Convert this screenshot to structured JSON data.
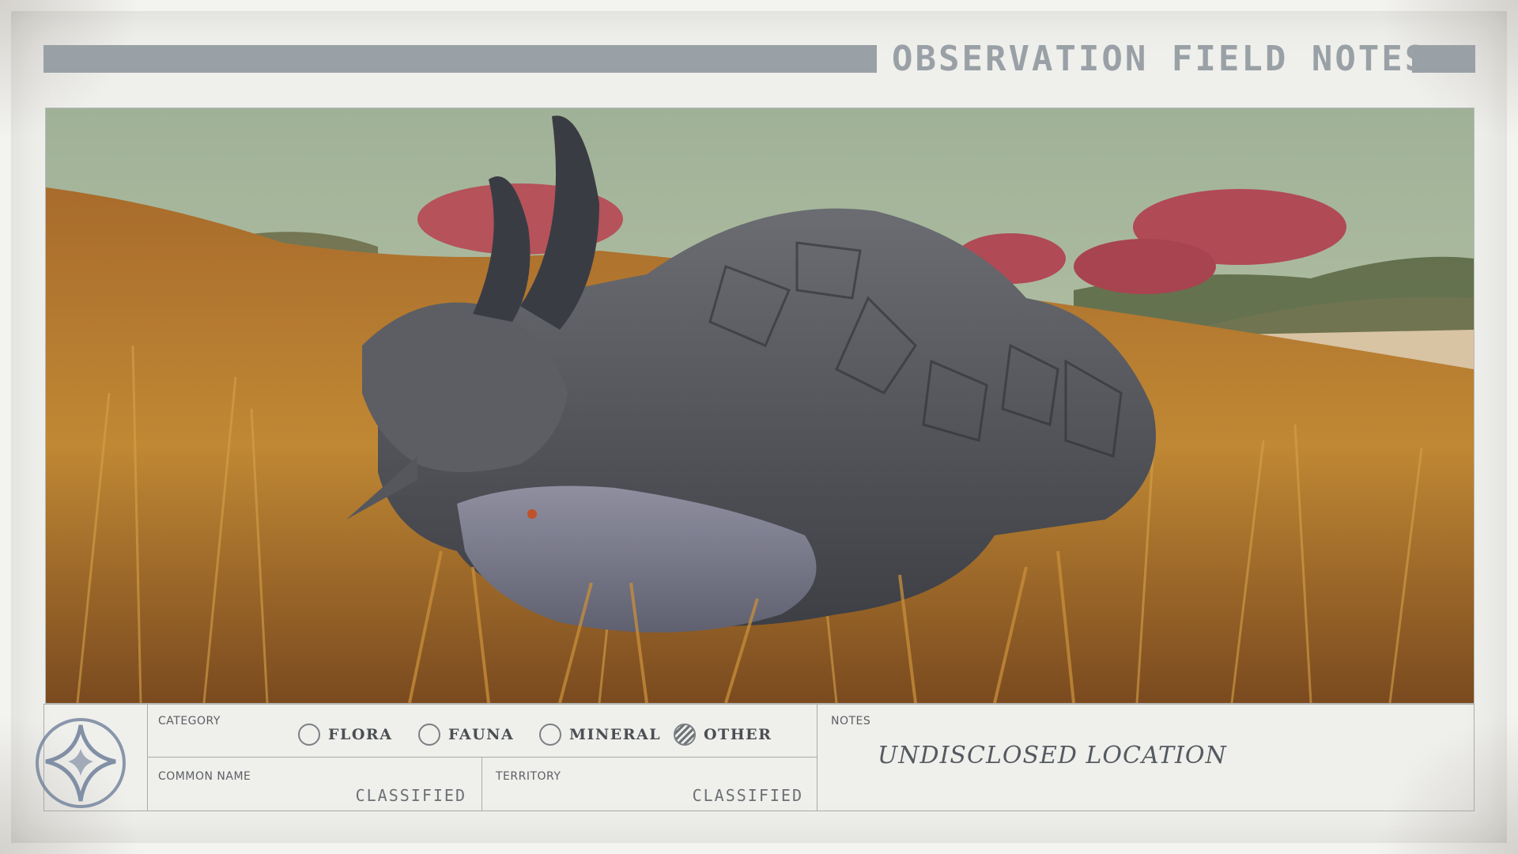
{
  "header": {
    "title": "OBSERVATION FIELD NOTES"
  },
  "photo": {
    "subject": "horned armored creature in tall grass"
  },
  "category": {
    "label": "CATEGORY",
    "options": [
      {
        "label": "FLORA",
        "selected": false
      },
      {
        "label": "FAUNA",
        "selected": false
      },
      {
        "label": "MINERAL",
        "selected": false
      },
      {
        "label": "OTHER",
        "selected": true
      }
    ]
  },
  "common_name": {
    "label": "COMMON NAME",
    "value": "CLASSIFIED"
  },
  "territory": {
    "label": "TERRITORY",
    "value": "CLASSIFIED"
  },
  "notes": {
    "label": "NOTES",
    "text": "UNDISCLOSED LOCATION"
  },
  "colors": {
    "header_bar": "#9aa1a6",
    "card": "#efefec",
    "sky": "#a4b497",
    "grass": "#b9802e"
  }
}
